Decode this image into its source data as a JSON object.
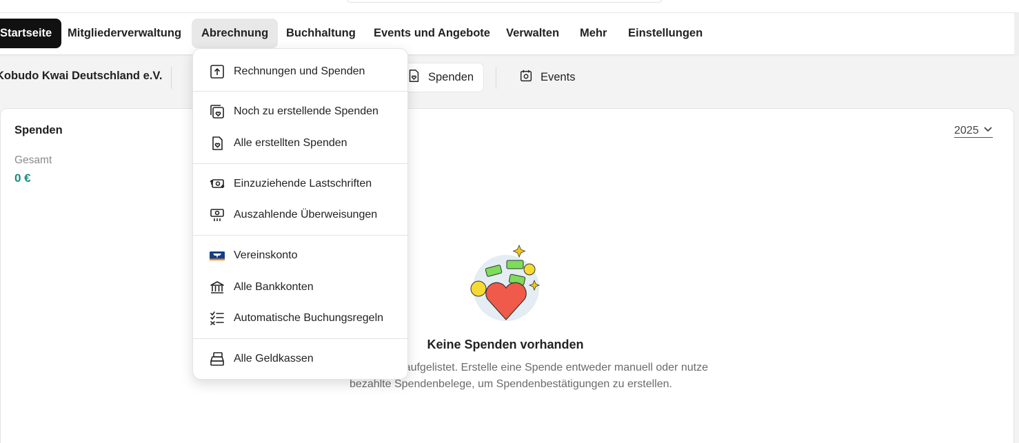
{
  "nav": {
    "items": [
      {
        "label": "Startseite"
      },
      {
        "label": "Mitgliederverwaltung"
      },
      {
        "label": "Abrechnung"
      },
      {
        "label": "Buchhaltung"
      },
      {
        "label": "Events und Angebote"
      },
      {
        "label": "Verwalten"
      },
      {
        "label": "Mehr"
      },
      {
        "label": "Einstellungen"
      }
    ]
  },
  "subbar": {
    "org_name": "Kobudo Kwai Deutschland e.V.",
    "tabs": [
      {
        "label": "Spenden",
        "icon": "heart-document-icon"
      },
      {
        "label": "Events",
        "icon": "calendar-icon"
      }
    ]
  },
  "panel": {
    "title": "Spenden",
    "total_label": "Gesamt",
    "total_value": "0 €",
    "year": "2025",
    "empty_title": "Keine Spenden vorhanden",
    "empty_text": "… ellten Spenden aufgelistet. Erstelle eine Spende entweder manuell oder nutze bezahlte Spendenbelege, um Spendenbestätigungen zu erstellen."
  },
  "dropdown": {
    "items": [
      {
        "label": "Rechnungen und Spenden",
        "icon": "upload-document-icon"
      },
      {
        "label": "Noch zu erstellende Spenden",
        "icon": "heart-stack-icon"
      },
      {
        "label": "Alle erstellten Spenden",
        "icon": "heart-document-icon"
      },
      {
        "label": "Einzuziehende Lastschriften",
        "icon": "money-exchange-icon"
      },
      {
        "label": "Auszahlende Überweisungen",
        "icon": "money-out-icon"
      },
      {
        "label": "Vereinskonto",
        "icon": "bank-logo-icon"
      },
      {
        "label": "Alle Bankkonten",
        "icon": "bank-building-icon"
      },
      {
        "label": "Automatische Buchungsregeln",
        "icon": "checklist-icon"
      },
      {
        "label": "Alle Geldkassen",
        "icon": "cash-register-icon"
      }
    ]
  },
  "colors": {
    "accent_teal": "#1a8a7e",
    "active_nav_bg": "#111111",
    "heart_red": "#f05a4a"
  }
}
